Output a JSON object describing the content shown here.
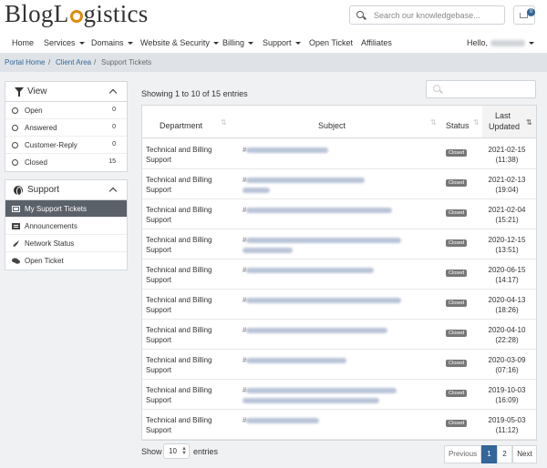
{
  "brand": {
    "name_before": "BlogL",
    "name_after": "gistics"
  },
  "header": {
    "search_placeholder": "Search our knowledgebase...",
    "cart_count": "0"
  },
  "nav": {
    "items": [
      "Home",
      "Services",
      "Domains",
      "Website & Security",
      "Billing",
      "Support",
      "Open Ticket",
      "Affiliates"
    ],
    "hello": "Hello,"
  },
  "breadcrumb": [
    "Portal Home",
    "Client Area",
    "Support Tickets"
  ],
  "view_panel": {
    "title": "View",
    "items": [
      {
        "label": "Open",
        "count": "0"
      },
      {
        "label": "Answered",
        "count": "0"
      },
      {
        "label": "Customer-Reply",
        "count": "0"
      },
      {
        "label": "Closed",
        "count": "15"
      }
    ]
  },
  "support_panel": {
    "title": "Support",
    "items": [
      {
        "label": "My Support Tickets",
        "icon": "ticket-icon"
      },
      {
        "label": "Announcements",
        "icon": "list-icon"
      },
      {
        "label": "Network Status",
        "icon": "rocket-icon"
      },
      {
        "label": "Open Ticket",
        "icon": "comments-icon"
      }
    ]
  },
  "table": {
    "showing": "Showing 1 to 10 of 15 entries",
    "headers": {
      "department": "Department",
      "subject": "Subject",
      "status": "Status",
      "last_updated_1": "Last",
      "last_updated_2": "Updated"
    },
    "rows": [
      {
        "dept1": "Technical and Billing",
        "dept2": "Support",
        "status": "Closed",
        "date": "2021-02-15",
        "time": "(11:38)"
      },
      {
        "dept1": "Technical and Billing",
        "dept2": "Support",
        "status": "Closed",
        "date": "2021-02-13",
        "time": "(19:04)"
      },
      {
        "dept1": "Technical and Billing",
        "dept2": "Support",
        "status": "Closed",
        "date": "2021-02-04",
        "time": "(15:21)"
      },
      {
        "dept1": "Technical and Billing",
        "dept2": "Support",
        "status": "Closed",
        "date": "2020-12-15",
        "time": "(13:51)"
      },
      {
        "dept1": "Technical and Billing",
        "dept2": "Support",
        "status": "Closed",
        "date": "2020-06-15",
        "time": "(14:17)"
      },
      {
        "dept1": "Technical and Billing",
        "dept2": "Support",
        "status": "Closed",
        "date": "2020-04-13",
        "time": "(18:26)"
      },
      {
        "dept1": "Technical and Billing",
        "dept2": "Support",
        "status": "Closed",
        "date": "2020-04-10",
        "time": "(22:28)"
      },
      {
        "dept1": "Technical and Billing",
        "dept2": "Support",
        "status": "Closed",
        "date": "2020-03-09",
        "time": "(07:16)"
      },
      {
        "dept1": "Technical and Billing",
        "dept2": "Support",
        "status": "Closed",
        "date": "2019-10-03",
        "time": "(16:09)"
      },
      {
        "dept1": "Technical and Billing",
        "dept2": "Support",
        "status": "Closed",
        "date": "2019-05-03",
        "time": "(11:12)"
      }
    ]
  },
  "footer": {
    "show": "Show",
    "page_size": "10",
    "entries": "entries",
    "previous": "Previous",
    "page1": "1",
    "page2": "2",
    "next": "Next"
  },
  "colors": {
    "accent": "#336699",
    "logo_ring": "#e08a0b",
    "badge_closed": "#777777",
    "active_sidebar": "#5a6169"
  }
}
